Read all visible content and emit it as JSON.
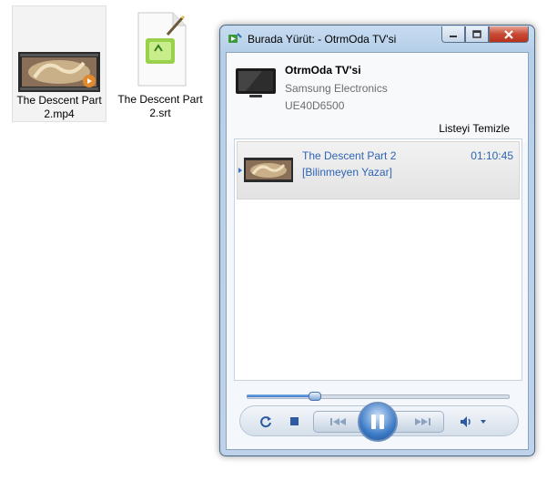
{
  "desktop": {
    "files": [
      {
        "name_line1": "The Descent Part",
        "name_line2": "2.mp4",
        "icon": "video-file-icon"
      },
      {
        "name_line1": "The Descent Part",
        "name_line2": "2.srt",
        "icon": "subtitle-file-icon"
      }
    ]
  },
  "window": {
    "title": "Burada Yürüt: - OtrmOda TV'si",
    "buttons": {
      "minimize": "minimize-icon",
      "maximize": "maximize-icon",
      "close": "close-icon"
    }
  },
  "device": {
    "name": "OtrmOda TV'si",
    "manufacturer": "Samsung Electronics",
    "model": "UE40D6500",
    "icon": "tv-icon"
  },
  "playlist": {
    "clear_label": "Listeyi Temizle",
    "items": [
      {
        "title": "The Descent Part 2",
        "artist": "[Bilinmeyen Yazar]",
        "duration": "01:10:45"
      }
    ]
  },
  "playback": {
    "progress": 0.26,
    "state": "playing",
    "controls": [
      "repeat-icon",
      "stop-icon",
      "previous-icon",
      "pause-icon",
      "next-icon",
      "volume-icon",
      "volume-dropdown-icon"
    ]
  },
  "colors": {
    "accent": "#2e64b4",
    "link": "#2e64b4",
    "close": "#c74a34"
  }
}
